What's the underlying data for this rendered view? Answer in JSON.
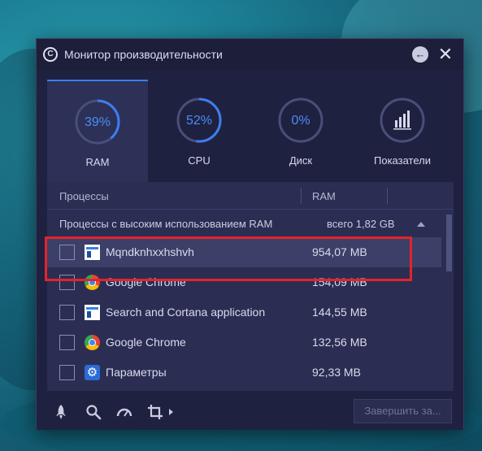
{
  "window": {
    "title": "Монитор производительности"
  },
  "tabs": [
    {
      "label": "RAM",
      "value": "39%",
      "percent": 39,
      "active": true,
      "icon": "ram-gauge-icon"
    },
    {
      "label": "CPU",
      "value": "52%",
      "percent": 52,
      "active": false,
      "icon": "cpu-gauge-icon"
    },
    {
      "label": "Диск",
      "value": "0%",
      "percent": 0,
      "active": false,
      "icon": "disk-gauge-icon"
    },
    {
      "label": "Показатели",
      "active": false,
      "icon": "bar-chart-icon"
    }
  ],
  "table": {
    "col_processes": "Процессы",
    "col_ram": "RAM",
    "group": {
      "title": "Процессы с высоким использованием RAM",
      "total": "всего 1,82 GB",
      "expanded": true
    },
    "rows": [
      {
        "name": "Mqndknhxxhshvh",
        "ram": "954,07 MB",
        "icon": "window-app-icon",
        "selected": true
      },
      {
        "name": "Google Chrome",
        "ram": "154,09 MB",
        "icon": "chrome-icon",
        "selected": false
      },
      {
        "name": "Search and Cortana application",
        "ram": "144,55 MB",
        "icon": "window-app-icon",
        "selected": false
      },
      {
        "name": "Google Chrome",
        "ram": "132,56 MB",
        "icon": "chrome-icon",
        "selected": false
      },
      {
        "name": "Параметры",
        "ram": "92,33 MB",
        "icon": "gear-icon",
        "selected": false
      }
    ]
  },
  "bottom": {
    "tools": [
      "rocket-icon",
      "search-icon",
      "speedometer-icon",
      "crop-icon",
      "play-arrow-icon"
    ],
    "finish_label": "Завершить за..."
  },
  "colors": {
    "accent": "#3d7df0",
    "highlight": "#e3242b"
  }
}
